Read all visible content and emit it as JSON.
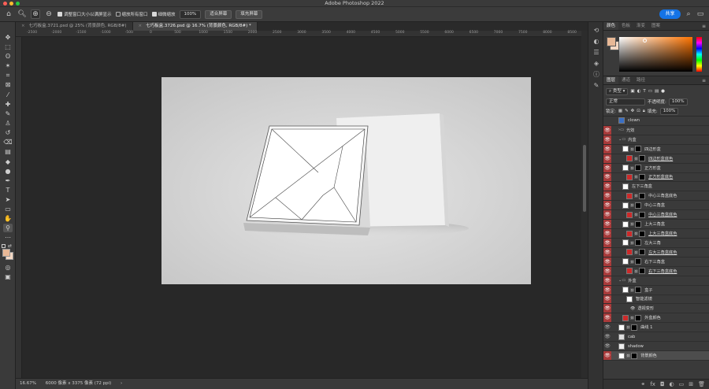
{
  "window": {
    "title": "Adobe Photoshop 2022",
    "share_label": "共享"
  },
  "options": {
    "resize_windows_label": "调整窗口大小以满屏显示",
    "zoom_all_label": "缩放所有窗口",
    "scrubby_zoom_label": "细微缩放",
    "zoom_value": "100%",
    "fit_screen_label": "适合屏幕",
    "fill_screen_label": "填充屏幕"
  },
  "tabs": [
    {
      "label": "七巧板盒.3721.psd @ 25% (背景颜色, RGB/8#)",
      "active": false
    },
    {
      "label": "七巧板盒.3726.psd @ 16.7% (背景颜色, RGB/8#) *",
      "active": true
    }
  ],
  "status": {
    "zoom": "16.67%",
    "dimensions": "6000 像素 x 3375 像素 (72 ppi)"
  },
  "ruler_labels": [
    "-2500",
    "-2000",
    "-1500",
    "-1000",
    "-500",
    "0",
    "500",
    "1000",
    "1500",
    "2000",
    "2500",
    "3000",
    "3500",
    "4000",
    "4500",
    "5000",
    "5500",
    "6000",
    "6500",
    "7000",
    "7500",
    "8000",
    "8500"
  ],
  "colors": {
    "foreground": "#e8b896",
    "background": "#f4d8c4"
  },
  "color_panel": {
    "tabs": [
      "颜色",
      "色板",
      "渐变",
      "图案"
    ]
  },
  "layers_panel": {
    "tabs": [
      "图层",
      "通道",
      "路径"
    ],
    "filter_label": "类型",
    "blend_mode": "正常",
    "opacity_label": "不透明度:",
    "opacity_value": "100%",
    "lock_label": "锁定:",
    "fill_label": "填充:",
    "fill_value": "100%"
  },
  "layers": [
    {
      "name": "clown",
      "indent": 1,
      "eye": "none",
      "thumb": "#3a6fc4",
      "mask": false
    },
    {
      "name": "光效",
      "indent": 1,
      "eye": "red",
      "group": true,
      "mask": false
    },
    {
      "name": "内盒",
      "indent": 1,
      "eye": "red",
      "group": true,
      "open": true,
      "mask": false
    },
    {
      "name": "四边形盒",
      "indent": 2,
      "eye": "red",
      "thumb": "#ffffff",
      "mask": true
    },
    {
      "name": "四边形盒底色",
      "indent": 3,
      "eye": "red",
      "thumb": "#cc2a2a",
      "mask": true,
      "underline": true
    },
    {
      "name": "正方形盒",
      "indent": 2,
      "eye": "red",
      "thumb": "#ffffff",
      "mask": true
    },
    {
      "name": "正方形盒底色",
      "indent": 3,
      "eye": "red",
      "thumb": "#cc2a2a",
      "mask": true,
      "underline": true
    },
    {
      "name": "左下三角盒",
      "indent": 2,
      "eye": "red",
      "thumb": "#ffffff",
      "mask": false
    },
    {
      "name": "中心三角盒底色",
      "indent": 3,
      "eye": "red",
      "thumb": "#cc2a2a",
      "mask": true
    },
    {
      "name": "中心三角盒",
      "indent": 2,
      "eye": "red",
      "thumb": "#ffffff",
      "mask": true
    },
    {
      "name": "中心三角盒底色",
      "indent": 3,
      "eye": "red",
      "thumb": "#cc2a2a",
      "mask": true,
      "underline": true
    },
    {
      "name": "上大三角盒",
      "indent": 2,
      "eye": "red",
      "thumb": "#ffffff",
      "mask": true
    },
    {
      "name": "上大三角盒底色",
      "indent": 3,
      "eye": "red",
      "thumb": "#cc2a2a",
      "mask": true,
      "underline": true
    },
    {
      "name": "左大三角",
      "indent": 2,
      "eye": "red",
      "thumb": "#ffffff",
      "mask": true
    },
    {
      "name": "左大三角盒底色",
      "indent": 3,
      "eye": "red",
      "thumb": "#cc2a2a",
      "mask": true,
      "underline": true
    },
    {
      "name": "右下三角盒",
      "indent": 2,
      "eye": "red",
      "thumb": "#ffffff",
      "mask": true
    },
    {
      "name": "右下三角盒底色",
      "indent": 3,
      "eye": "red",
      "thumb": "#cc2a2a",
      "mask": true,
      "underline": true
    },
    {
      "name": "外盒",
      "indent": 1,
      "eye": "red",
      "group": true,
      "open": true,
      "mask": false
    },
    {
      "name": "盒子",
      "indent": 2,
      "eye": "red",
      "thumb": "#ffffff",
      "mask": true
    },
    {
      "name": "智能滤镜",
      "indent": 3,
      "eye": "red",
      "thumb": "#ffffff",
      "mask": false
    },
    {
      "name": "透视变形",
      "indent": 4,
      "eye": "red",
      "mask": false
    },
    {
      "name": "外盒颜色",
      "indent": 2,
      "eye": "red",
      "thumb": "#cc2a2a",
      "mask": true
    },
    {
      "name": "曲线 1",
      "indent": 1,
      "eye": "normal",
      "thumb": "#ffffff",
      "mask": true
    },
    {
      "name": "cab",
      "indent": 1,
      "eye": "normal",
      "thumb": "#dddddd",
      "mask": false
    },
    {
      "name": "shadow",
      "indent": 1,
      "eye": "normal",
      "thumb": "#eeeeee",
      "mask": false
    },
    {
      "name": "背景颜色",
      "indent": 1,
      "eye": "red",
      "thumb": "#ffffff",
      "mask": true,
      "selected": true
    }
  ]
}
